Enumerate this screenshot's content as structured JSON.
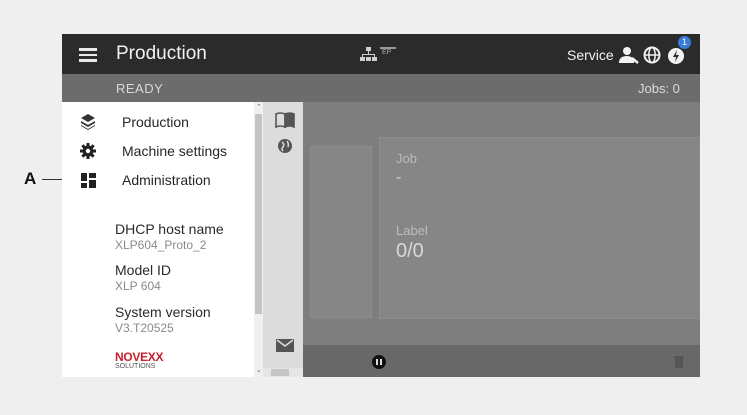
{
  "header": {
    "title": "Production",
    "network_badge": "EP",
    "service_label": "Service",
    "notification_count": "1"
  },
  "status": {
    "state": "READY",
    "jobs": "Jobs: 0"
  },
  "main": {
    "job_label": "Job",
    "job_value": "-",
    "label_label": "Label",
    "label_value": "0/0"
  },
  "drawer": {
    "items": [
      {
        "label": "Production",
        "icon": "layers-icon"
      },
      {
        "label": "Machine settings",
        "icon": "gear-icon"
      },
      {
        "label": "Administration",
        "icon": "dashboard-icon"
      }
    ],
    "info": {
      "dhcp_label": "DHCP host name",
      "dhcp_value": "XLP604_Proto_2",
      "model_label": "Model ID",
      "model_value": "XLP 604",
      "version_label": "System version",
      "version_value": "V3.T20525"
    },
    "logo_text": "NOVEXX",
    "logo_subtext": "SOLUTIONS"
  },
  "annotation": {
    "callout": "A"
  },
  "colors": {
    "topbar": "#2b2b2b",
    "notification": "#3a7bd5",
    "logo_red": "#c8202f"
  }
}
